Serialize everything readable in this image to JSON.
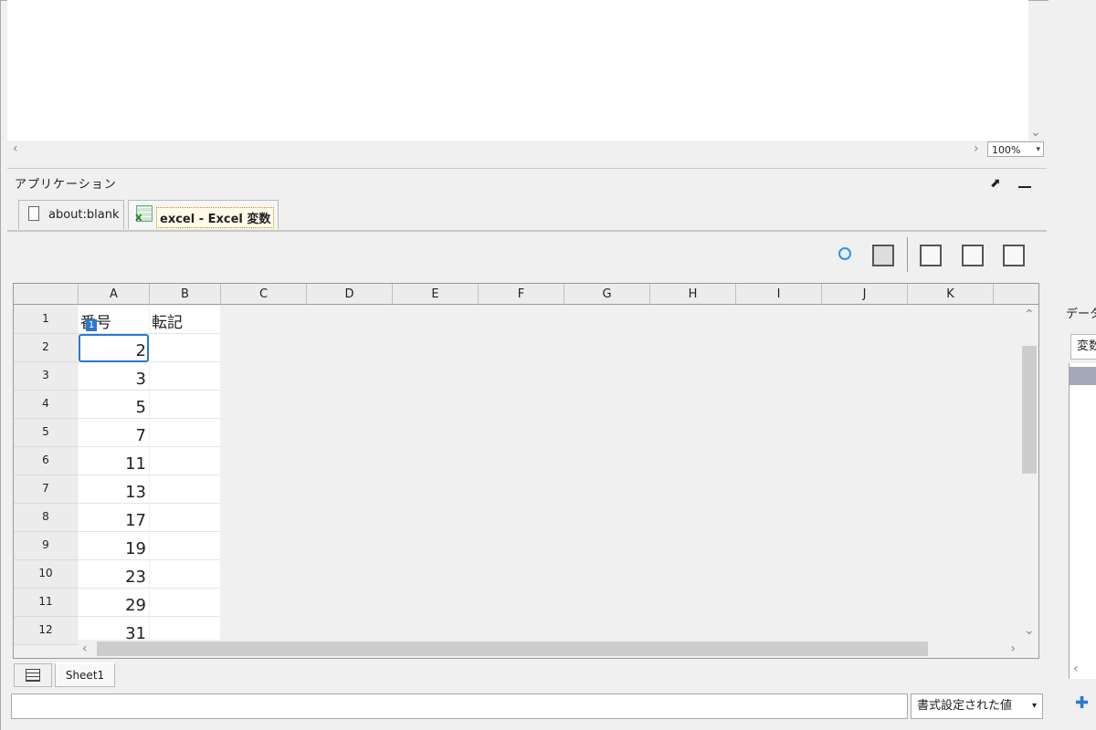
{
  "zoom": "100%",
  "app_panel": {
    "title": "アプリケーション"
  },
  "tabs": [
    {
      "label": "about:blank"
    },
    {
      "label": "excel - Excel 変数"
    }
  ],
  "grid": {
    "columns": [
      "A",
      "B",
      "C",
      "D",
      "E",
      "F",
      "G",
      "H",
      "I",
      "J",
      "K"
    ],
    "rows": [
      {
        "num": "1",
        "a": "番号",
        "b": "転記"
      },
      {
        "num": "2",
        "a": "2",
        "b": ""
      },
      {
        "num": "3",
        "a": "3",
        "b": ""
      },
      {
        "num": "4",
        "a": "5",
        "b": ""
      },
      {
        "num": "5",
        "a": "7",
        "b": ""
      },
      {
        "num": "6",
        "a": "11",
        "b": ""
      },
      {
        "num": "7",
        "a": "13",
        "b": ""
      },
      {
        "num": "8",
        "a": "17",
        "b": ""
      },
      {
        "num": "9",
        "a": "19",
        "b": ""
      },
      {
        "num": "10",
        "a": "23",
        "b": ""
      },
      {
        "num": "11",
        "a": "29",
        "b": ""
      },
      {
        "num": "12",
        "a": "31",
        "b": ""
      }
    ],
    "selected_badge": "1"
  },
  "sheet_tab": "Sheet1",
  "formula_bar": {
    "value": ""
  },
  "format_select": {
    "value": "書式設定された値"
  },
  "right_panel": {
    "label": "データ",
    "tab": "変数"
  },
  "icons": {
    "left_arrow": "‹",
    "right_arrow": "›",
    "up_arrow": "⌃",
    "down_arrow": "⌄",
    "dropdown": "▾",
    "pin": "⬈",
    "plus": "✚"
  }
}
